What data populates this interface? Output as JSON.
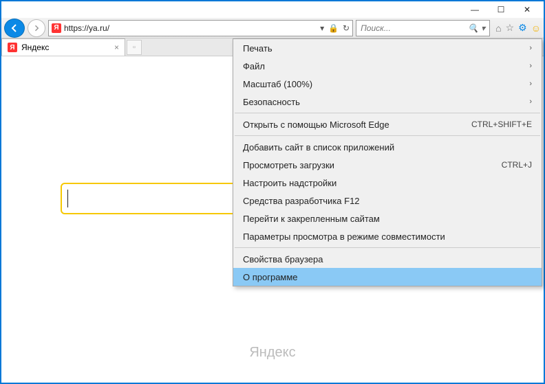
{
  "window": {
    "min": "—",
    "max": "☐",
    "close": "✕"
  },
  "address": {
    "url": "https://ya.ru/",
    "dropdown": "▾",
    "lock": "🔒",
    "refresh": "↻"
  },
  "search": {
    "placeholder": "Поиск...",
    "mag": "🔍",
    "drop": "▾"
  },
  "toolbar_icons": {
    "home": "⌂",
    "star": "☆",
    "gear": "⚙",
    "smile": "☺"
  },
  "tab": {
    "fav": "Я",
    "title": "Яндекс",
    "close": "×",
    "newtab": "▫"
  },
  "page": {
    "footer": "Яндекс"
  },
  "menu": {
    "items": [
      {
        "label": "Печать",
        "sub": true
      },
      {
        "label": "Файл",
        "sub": true
      },
      {
        "label": "Масштаб (100%)",
        "sub": true
      },
      {
        "label": "Безопасность",
        "sub": true
      }
    ],
    "edge": {
      "label": "Открыть с помощью Microsoft Edge",
      "kbd": "CTRL+SHIFT+E"
    },
    "items2": [
      {
        "label": "Добавить сайт в список приложений"
      },
      {
        "label": "Просмотреть загрузки",
        "kbd": "CTRL+J"
      },
      {
        "label": "Настроить надстройки"
      },
      {
        "label": "Средства разработчика F12"
      },
      {
        "label": "Перейти к закрепленным сайтам"
      },
      {
        "label": "Параметры просмотра в режиме совместимости"
      }
    ],
    "items3": [
      {
        "label": "Свойства браузера"
      },
      {
        "label": "О программе",
        "hl": true
      }
    ]
  }
}
